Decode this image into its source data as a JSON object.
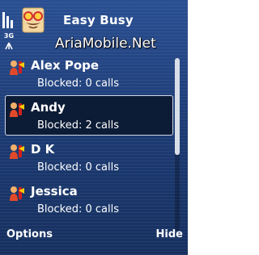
{
  "app": {
    "title": "Easy Busy",
    "watermark": "AriaMobile.Net"
  },
  "status": {
    "network": "3G"
  },
  "contacts": [
    {
      "name": "Alex Pope",
      "status": "Blocked: 0 calls",
      "selected": false
    },
    {
      "name": "Andy",
      "status": "Blocked: 2 calls",
      "selected": true
    },
    {
      "name": "D K",
      "status": "Blocked: 0 calls",
      "selected": false
    },
    {
      "name": "Jessica",
      "status": "Blocked: 0 calls",
      "selected": false
    }
  ],
  "softkeys": {
    "left": "Options",
    "right": "Hide"
  },
  "scroll": {
    "position": 0.0
  }
}
